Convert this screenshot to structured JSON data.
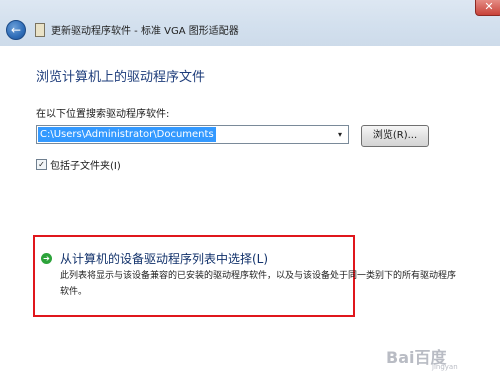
{
  "window": {
    "title": "更新驱动程序软件 - 标准 VGA 图形适配器",
    "close_label": "✕",
    "back_label": "←"
  },
  "main": {
    "heading": "浏览计算机上的驱动程序文件",
    "search_label": "在以下位置搜索驱动程序软件:",
    "path_value": "C:\\Users\\Administrator\\Documents",
    "combo_arrow": "▾",
    "browse_button": "浏览(R)...",
    "include_subfolders": {
      "label": "包括子文件夹(I)",
      "checked": true,
      "mark": "✓"
    },
    "pick_option": {
      "arrow": "➔",
      "title": "从计算机的设备驱动程序列表中选择(L)",
      "description": "此列表将显示与该设备兼容的已安装的驱动程序软件，以及与该设备处于同一类别下的所有驱动程序软件。"
    }
  },
  "watermark": {
    "text": "Bai百度",
    "sub": "jingyan"
  },
  "colors": {
    "heading": "#1e3d7b",
    "selection": "#3399ff",
    "highlight_border": "#e0161c",
    "arrow_green": "#2ca33a"
  }
}
